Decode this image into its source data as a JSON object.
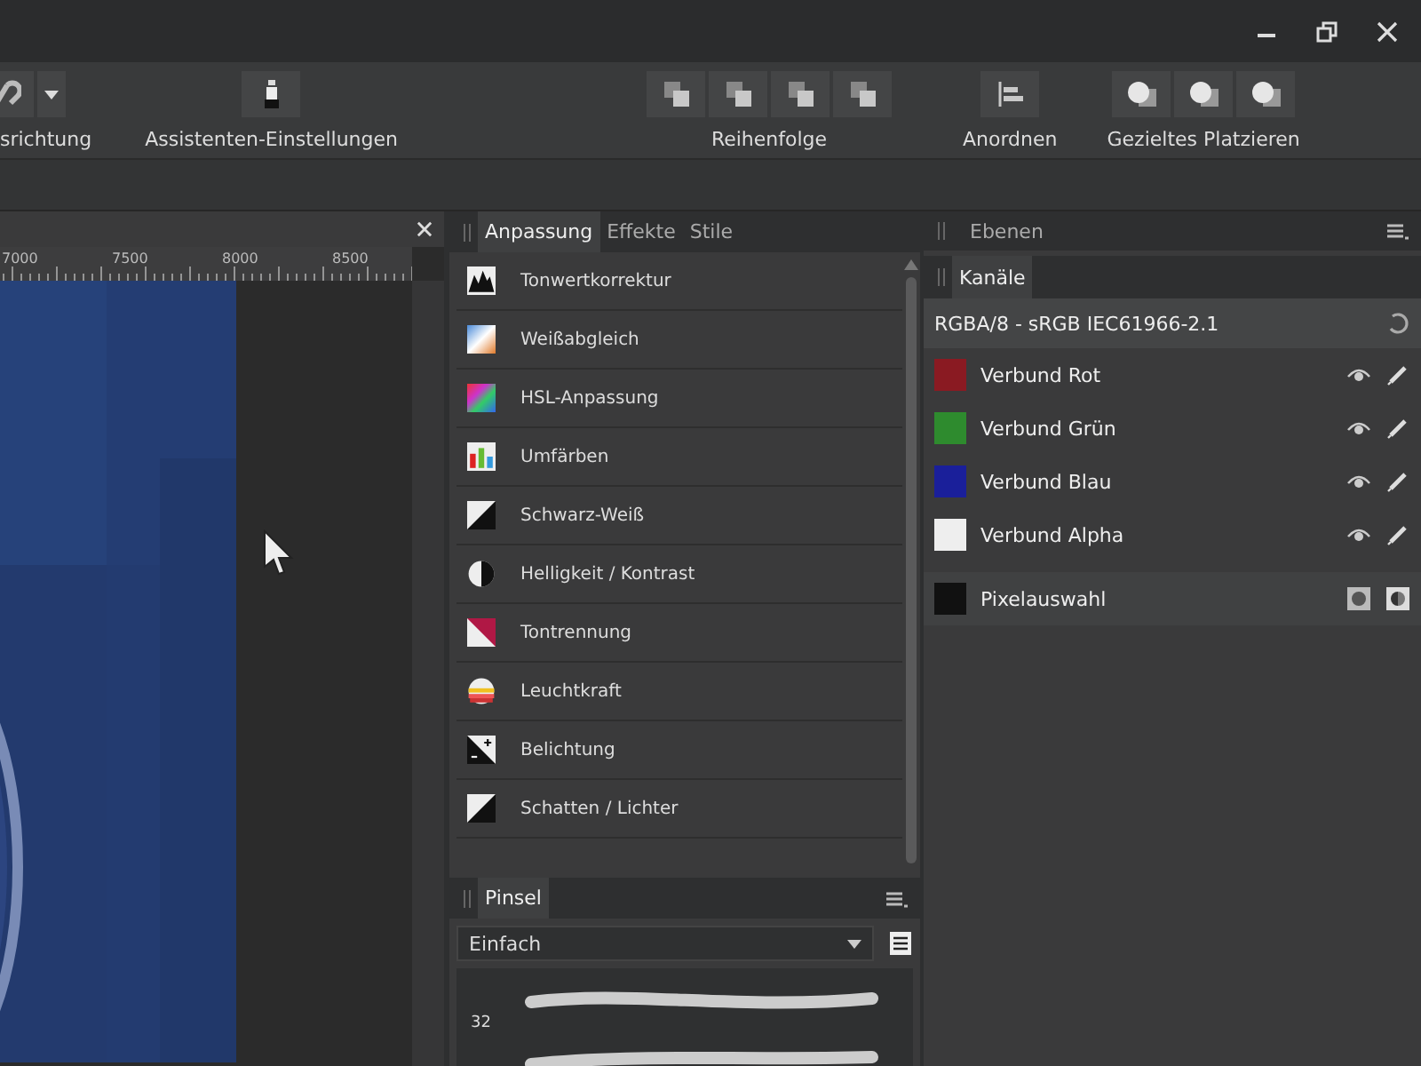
{
  "toolbar": {
    "groups": [
      {
        "label": "srichtung"
      },
      {
        "label": "Assistenten-Einstellungen"
      },
      {
        "label": "Reihenfolge"
      },
      {
        "label": "Anordnen"
      },
      {
        "label": "Gezieltes Platzieren"
      }
    ]
  },
  "document": {
    "ruler": [
      "7000",
      "7500",
      "8000",
      "8500"
    ]
  },
  "adjustments": {
    "tabs": [
      {
        "label": "Anpassung",
        "selected": true
      },
      {
        "label": "Effekte",
        "selected": false
      },
      {
        "label": "Stile",
        "selected": false
      }
    ],
    "items": [
      "Tonwertkorrektur",
      "Weißabgleich",
      "HSL-Anpassung",
      "Umfärben",
      "Schwarz-Weiß",
      "Helligkeit / Kontrast",
      "Tontrennung",
      "Leuchtkraft",
      "Belichtung",
      "Schatten / Lichter"
    ]
  },
  "brushes": {
    "tab": "Pinsel",
    "category": "Einfach",
    "sizes": [
      "32"
    ]
  },
  "layers": {
    "tab": "Ebenen"
  },
  "channels": {
    "tab": "Kanäle",
    "profile": "RGBA/8 - sRGB IEC61966-2.1",
    "rows": [
      {
        "name": "Verbund Rot",
        "color": "#8a1a22",
        "kind": "channel"
      },
      {
        "name": "Verbund Grün",
        "color": "#2e8b2e",
        "kind": "channel"
      },
      {
        "name": "Verbund Blau",
        "color": "#1a1f9a",
        "kind": "channel"
      },
      {
        "name": "Verbund Alpha",
        "color": "#eeeeee",
        "kind": "channel"
      },
      {
        "name": "Pixelauswahl",
        "color": "#111111",
        "kind": "selection"
      }
    ]
  }
}
